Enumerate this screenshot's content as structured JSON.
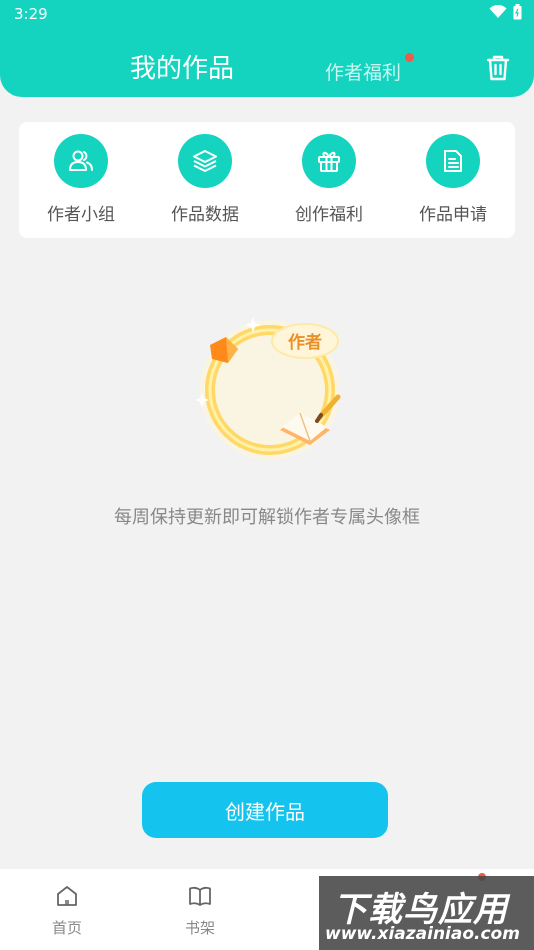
{
  "status_bar": {
    "time": "3:29",
    "icons": [
      "wifi-icon",
      "battery-icon"
    ]
  },
  "header": {
    "title": "我的作品",
    "welfare_tab": "作者福利",
    "trash_icon": "trash-icon"
  },
  "quick_actions": [
    {
      "label": "作者小组",
      "icon": "users-icon"
    },
    {
      "label": "作品数据",
      "icon": "layers-icon"
    },
    {
      "label": "创作福利",
      "icon": "gift-icon"
    },
    {
      "label": "作品申请",
      "icon": "document-icon"
    }
  ],
  "illustration": {
    "badge_text": "作者"
  },
  "message": "每周保持更新即可解锁作者专属头像框",
  "create_button": "创建作品",
  "bottom_nav": [
    {
      "label": "首页",
      "icon": "home-icon"
    },
    {
      "label": "书架",
      "icon": "book-icon"
    }
  ],
  "watermark": {
    "title": "下载鸟应用",
    "url": "www.xiazainiao.com"
  },
  "colors": {
    "primary": "#14d4bf",
    "button": "#14c4ef",
    "dot": "#ef5a4a",
    "background": "#f2f2f2"
  }
}
